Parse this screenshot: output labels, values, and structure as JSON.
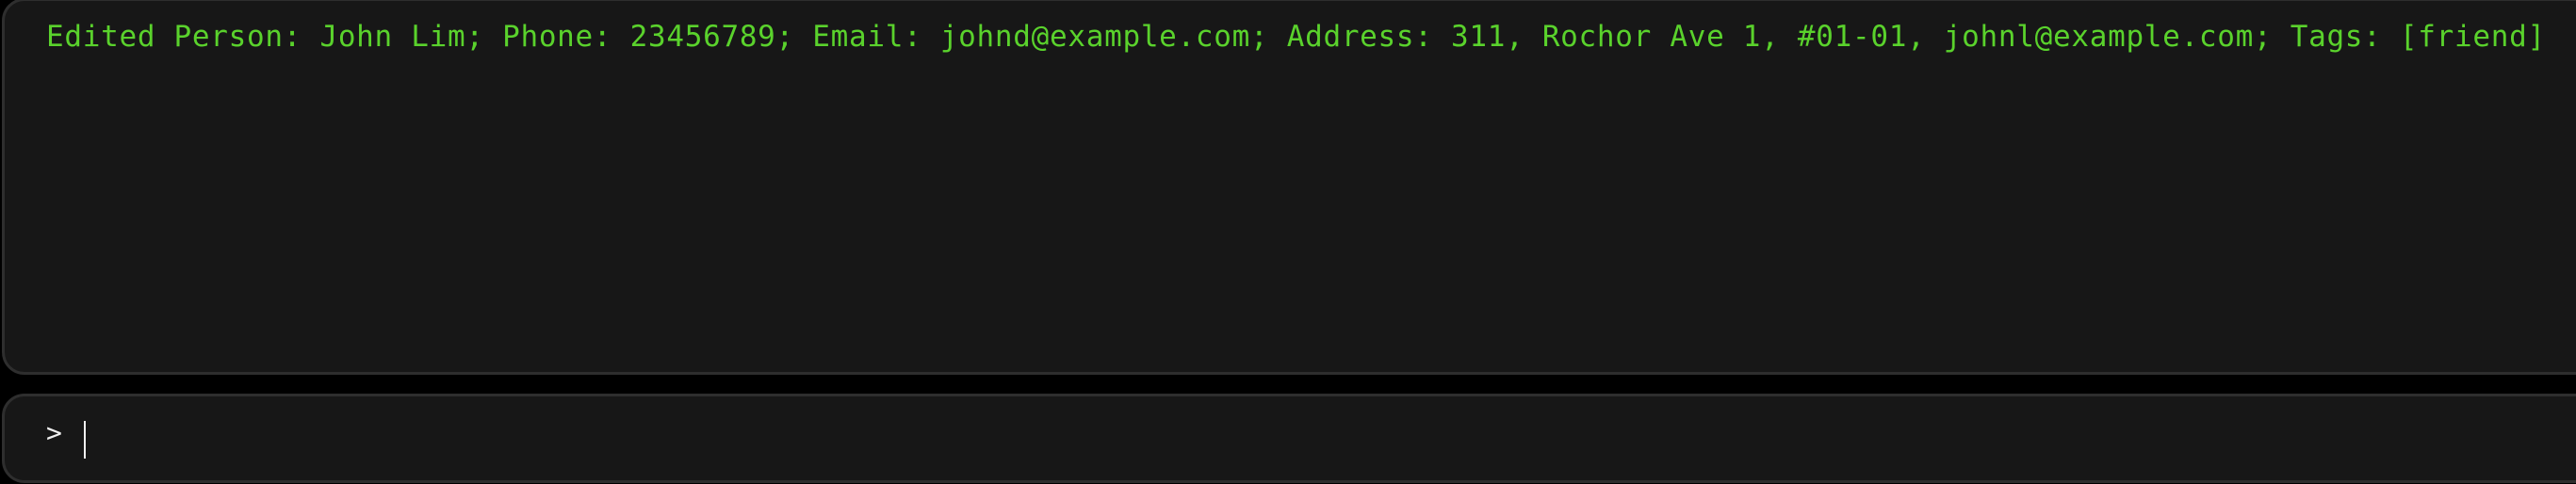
{
  "result_display": {
    "text": "Edited Person: John Lim; Phone: 23456789; Email: johnd@example.com; Address: 311, Rochor Ave 1, #01-01, johnl@example.com; Tags: [friend]"
  },
  "command_box": {
    "prompt": ">",
    "value": ""
  },
  "colors": {
    "result_text": "#5ad22c",
    "panel_bg": "#171717",
    "panel_border": "#2e2e2e"
  }
}
